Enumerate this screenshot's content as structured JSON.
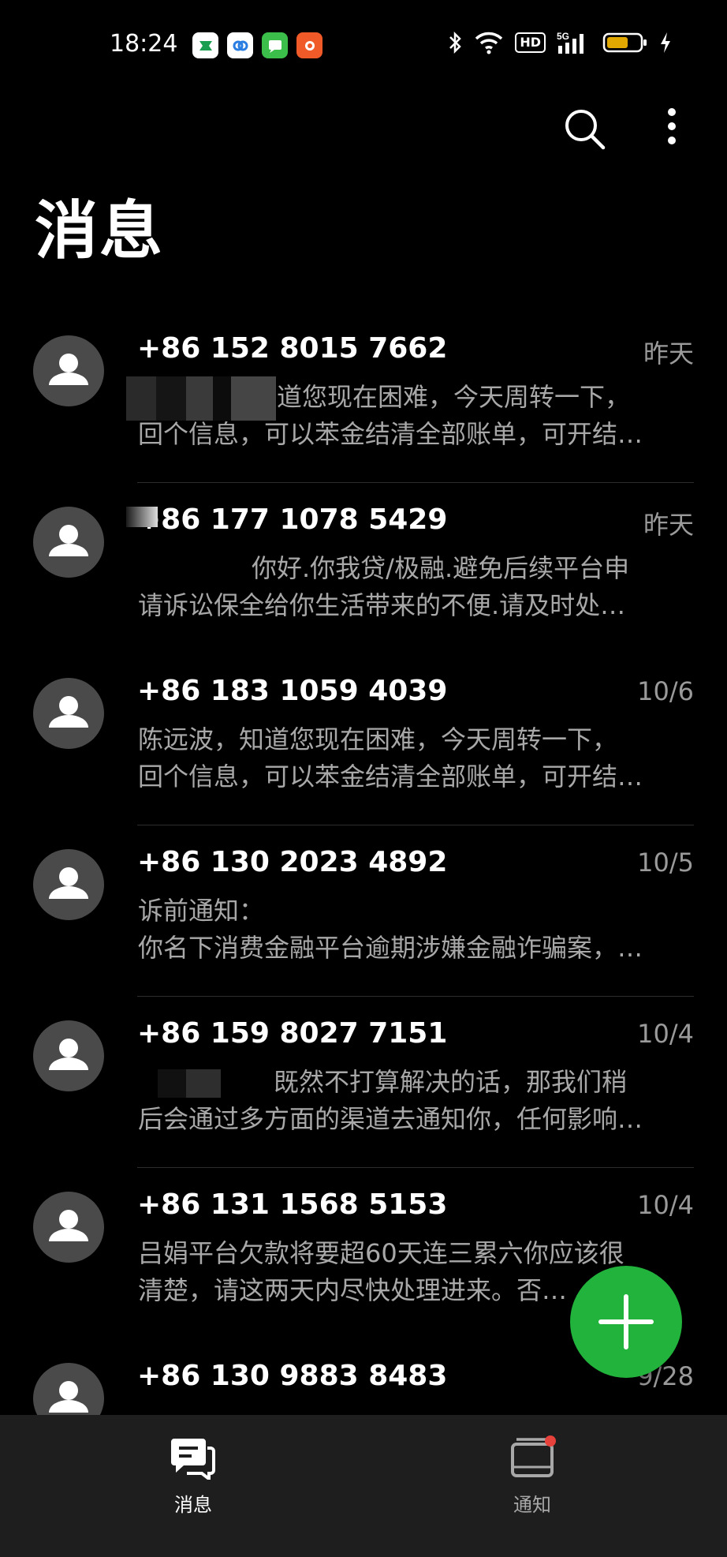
{
  "status_bar": {
    "time": "18:24",
    "app_icons": [
      "app-icon-green",
      "app-icon-blue",
      "app-icon-message",
      "app-icon-orange"
    ],
    "hd_label": "HD",
    "net_label": "5G",
    "battery_color": "#e0a800"
  },
  "header": {
    "title": "消息",
    "search_icon": "search-icon",
    "more_icon": "more-vert-icon"
  },
  "conversations": [
    {
      "sender": "+86 152 8015 7662",
      "date": "昨天",
      "line1": "知道您现在困难，今天周转一下，",
      "line2": "回个信息，可以苯金结清全部账单，可开结…"
    },
    {
      "sender": "+86 177 1078 5429",
      "date": "昨天",
      "line1": "你好.你我贷/极融.避免后续平台申",
      "line2": "请诉讼保全给你生活带来的不便.请及时处…"
    },
    {
      "sender": "+86 183 1059 4039",
      "date": "10/6",
      "line1": "陈远波，知道您现在困难，今天周转一下，",
      "line2": "回个信息，可以苯金结清全部账单，可开结…"
    },
    {
      "sender": "+86 130 2023 4892",
      "date": "10/5",
      "line1": "诉前通知：",
      "line2": "你名下消费金融平台逾期涉嫌金融诈骗案，…"
    },
    {
      "sender": "+86 159 8027 7151",
      "date": "10/4",
      "line1": "既然不打算解决的话，那我们稍",
      "line2": "后会通过多方面的渠道去通知你，任何影响…"
    },
    {
      "sender": "+86 131 1568 5153",
      "date": "10/4",
      "line1": "吕娟平台欠款将要超60天连三累六你应该很",
      "line2": "清楚，请这两天内尽快处理进来。否…"
    },
    {
      "sender": "+86 130 9883 8483",
      "date": "9/28",
      "line1": "",
      "line2": ""
    }
  ],
  "fab": {
    "icon": "plus-icon",
    "color": "#21b33c"
  },
  "bottom_nav": {
    "tabs": [
      {
        "label": "消息",
        "icon": "chat-bubble-icon",
        "active": true
      },
      {
        "label": "通知",
        "icon": "notification-box-icon",
        "active": false,
        "badge": true
      }
    ]
  }
}
